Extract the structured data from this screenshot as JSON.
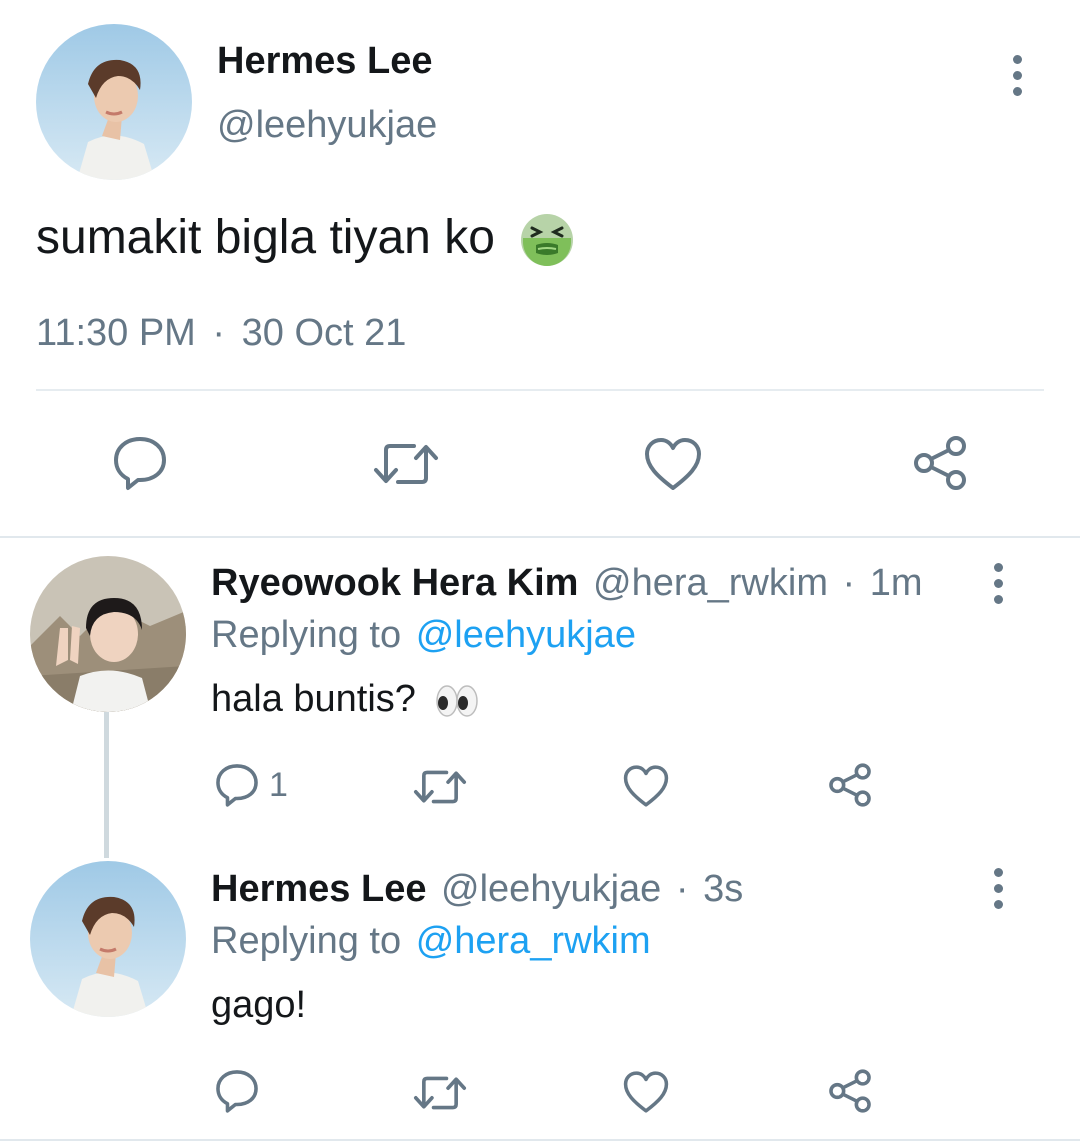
{
  "main_tweet": {
    "name": "Hermes Lee",
    "handle": "@leehyukjae",
    "text": "sumakit bigla tiyan ko",
    "emoji": "nauseated-face-emoji",
    "time": "11:30 PM",
    "separator": "·",
    "date": "30 Oct 21"
  },
  "replies": [
    {
      "name": "Ryeowook Hera Kim",
      "handle": "@hera_rwkim",
      "dot": "·",
      "age": "1m",
      "replying_label": "Replying to",
      "replying_to": "@leehyukjae",
      "text": "hala buntis?",
      "emoji": "eyes-emoji",
      "reply_count": "1"
    },
    {
      "name": "Hermes Lee",
      "handle": "@leehyukjae",
      "dot": "·",
      "age": "3s",
      "replying_label": "Replying to",
      "replying_to": "@hera_rwkim",
      "text": "gago!",
      "reply_count": ""
    }
  ],
  "colors": {
    "text": "#14171a",
    "muted": "#657786",
    "link": "#1da1f2",
    "divider": "#e6ecf0"
  },
  "icons": [
    "reply-icon",
    "retweet-icon",
    "like-icon",
    "share-icon",
    "more-options-icon"
  ]
}
